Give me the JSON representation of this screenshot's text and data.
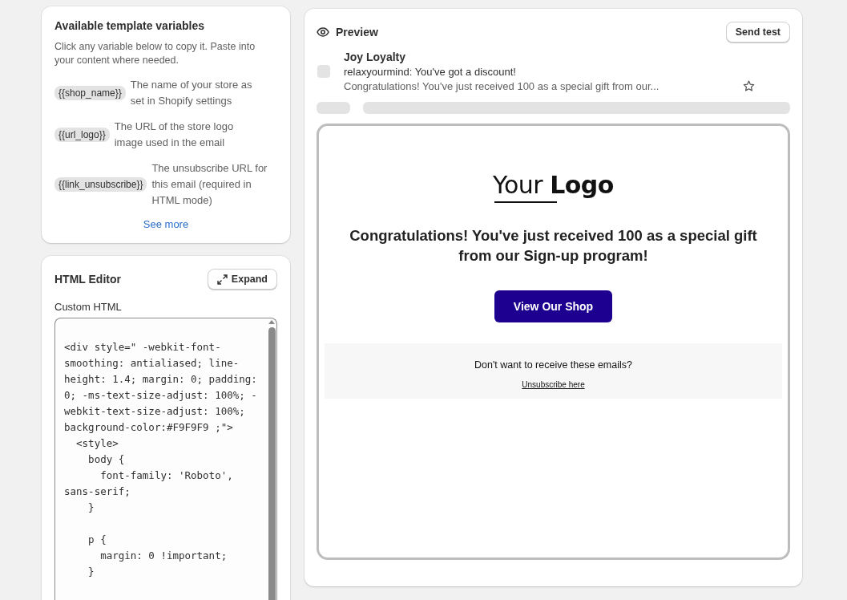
{
  "variables_card": {
    "title": "Available template variables",
    "description": "Click any variable below to copy it. Paste into your content where needed.",
    "variables": [
      {
        "token": "{{shop_name}}",
        "description": "The name of your store as set in Shopify settings"
      },
      {
        "token": "{{url_logo}}",
        "description": "The URL of the store logo image used in the email"
      },
      {
        "token": "{{link_unsubscribe}}",
        "description": "The unsubscribe URL for this email (required in HTML mode)"
      }
    ],
    "see_more": "See more"
  },
  "html_editor": {
    "title": "HTML Editor",
    "expand_button": "Expand",
    "field_label": "Custom HTML",
    "code": "<div style=\" -webkit-font-\nsmoothing: antialiased; line-\nheight: 1.4; margin: 0; padding:\n0; -ms-text-size-adjust: 100%; -\nwebkit-text-size-adjust: 100%;\nbackground-color:#F9F9F9 ;\">\n  <style>\n    body {\n      font-family: 'Roboto',\nsans-serif;\n    }\n\n    p {\n      margin: 0 !important;\n    }"
  },
  "preview": {
    "title": "Preview",
    "send_test_button": "Send test",
    "inbox": {
      "sender": "Joy Loyalty",
      "subject": "relaxyourmind: You've got a discount!",
      "snippet": "Congratulations! You've just received 100 as a special gift from our...",
      "starred": false
    },
    "email": {
      "logo": "Your **Logo**",
      "headline": "Congratulations! You've just received 100 as a special gift from our Sign-up program!",
      "cta_button": "View Our Shop",
      "footer_text": "Don't want to receive these emails?",
      "unsubscribe_link": "Unsubscribe here"
    }
  }
}
